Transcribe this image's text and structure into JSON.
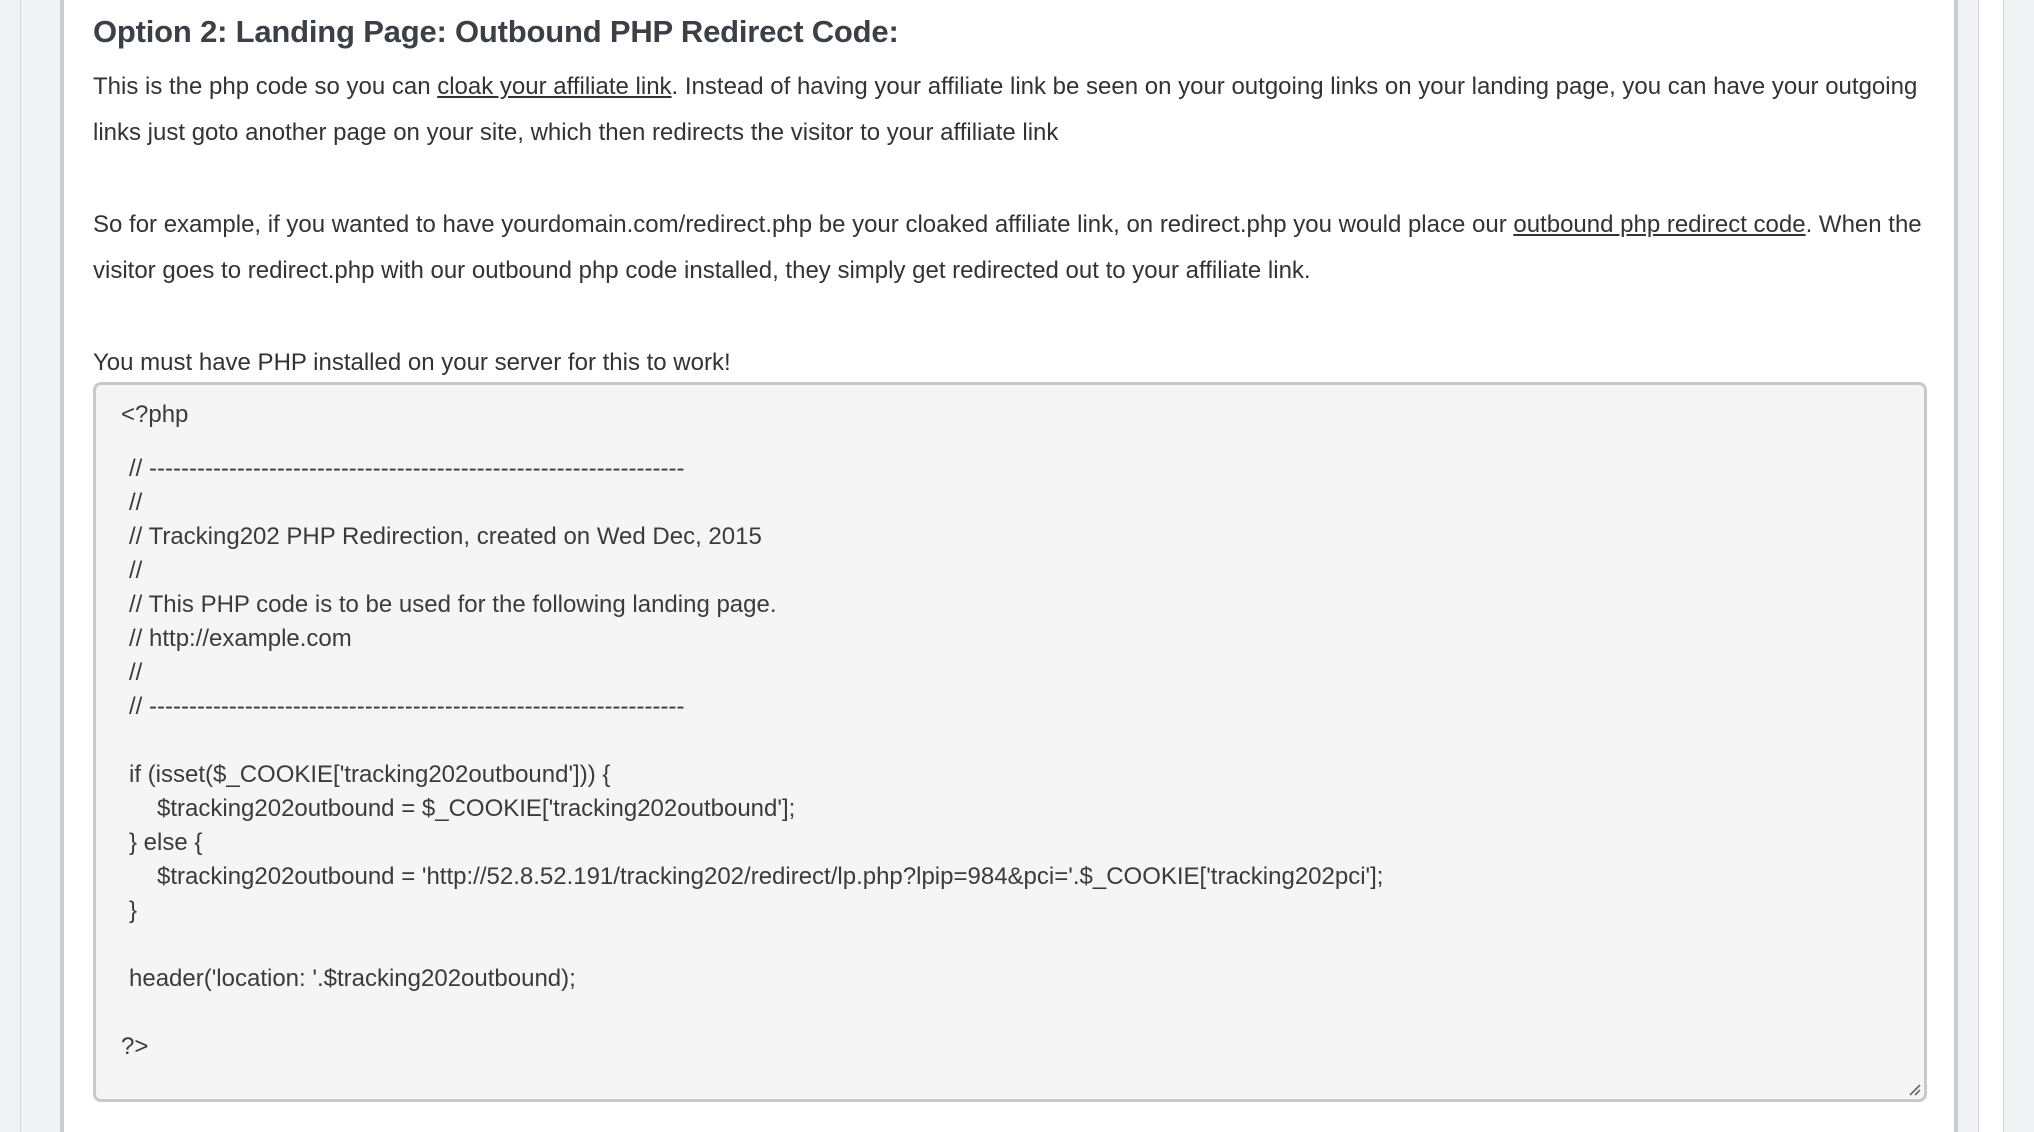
{
  "heading": "Option 2: Landing Page: Outbound PHP Redirect Code:",
  "paragraph1": {
    "before": "This is the php code so you can ",
    "link": "cloak your affiliate link",
    "after": ". Instead of having your affiliate link be seen on your outgoing links on your landing page, you can have your outgoing links just goto another page on your site, which then redirects the visitor to your affiliate link"
  },
  "paragraph2": {
    "before": "So for example, if you wanted to have yourdomain.com/redirect.php be your cloaked affiliate link, on redirect.php you would place our ",
    "link": "outbound php redirect code",
    "after": ". When the visitor goes to redirect.php with our outbound php code installed, they simply get redirected out to your affiliate link."
  },
  "paragraph3": "You must have PHP installed on your server for this to work!",
  "code": {
    "line01": "<?php",
    "line02": "// -------------------------------------------------------------------",
    "line03": "//",
    "line04": "// Tracking202 PHP Redirection, created on Wed Dec, 2015",
    "line05": "//",
    "line06": "// This PHP code is to be used for the following landing page.",
    "line07": "// http://example.com",
    "line08": "//",
    "line09": "// -------------------------------------------------------------------",
    "line10": "if (isset($_COOKIE['tracking202outbound'])) {",
    "line11": "$tracking202outbound = $_COOKIE['tracking202outbound'];",
    "line12": "} else {",
    "line13": "$tracking202outbound = 'http://52.8.52.191/tracking202/redirect/lp.php?lpip=984&pci='.$_COOKIE['tracking202pci'];",
    "line14": "}",
    "line15": "header('location: '.$tracking202outbound);",
    "line16": "?>"
  }
}
